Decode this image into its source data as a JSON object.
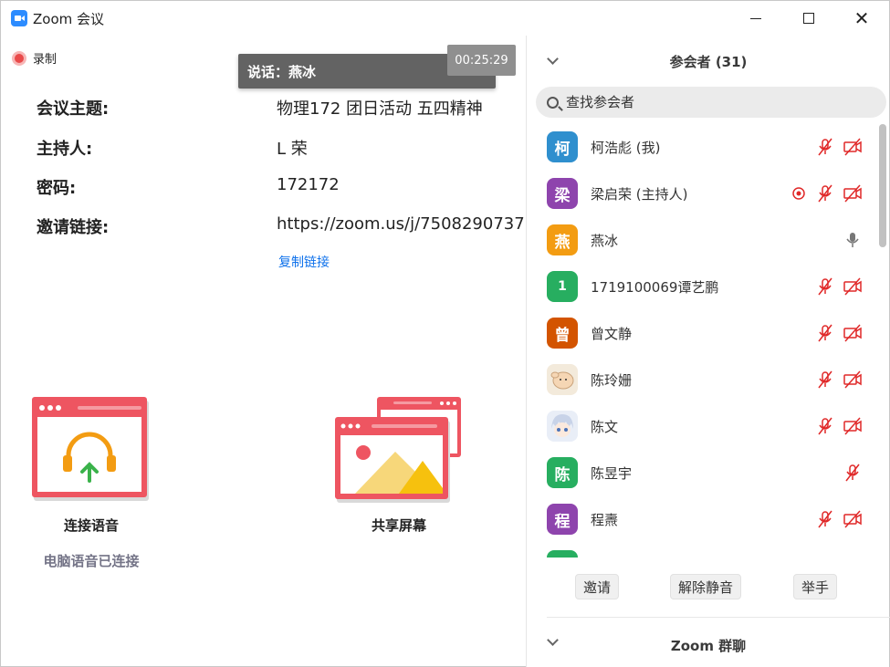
{
  "window": {
    "title": "Zoom 会议"
  },
  "recording": {
    "label": "录制"
  },
  "speaker_tip": "说话：燕冰",
  "timer": "00:25:29",
  "meeting_info": {
    "topic_key": "会议主题:",
    "topic_val": "物理172 团日活动 五四精神",
    "host_key": "主持人:",
    "host_val": "L 荣",
    "password_key": "密码:",
    "password_val": "172172",
    "link_key": "邀请链接:",
    "link_val": "https://zoom.us/j/7508290737",
    "copy_link": "复制链接"
  },
  "actions": {
    "audio_label": "连接语音",
    "audio_status": "电脑语音已连接",
    "share_label": "共享屏幕"
  },
  "participants_panel": {
    "title": "参会者 (31)",
    "search_placeholder": "查找参会者",
    "participants": [
      {
        "initial": "柯",
        "name": "柯浩彪 (我)",
        "avatar_color": "#2f8fce",
        "mic": "muted",
        "video": "off"
      },
      {
        "initial": "梁",
        "name": "梁启荣 (主持人)",
        "avatar_color": "#8e44ad",
        "recording": true,
        "mic": "muted",
        "video": "off"
      },
      {
        "initial": "燕",
        "name": "燕冰",
        "avatar_color": "#f39c12",
        "mic": "speaking"
      },
      {
        "initial": "1",
        "name": "1719100069谭艺鹏",
        "avatar_color": "#27ae60",
        "mic": "muted",
        "video": "off"
      },
      {
        "initial": "曾",
        "name": "曾文静",
        "avatar_color": "#d35400",
        "mic": "muted",
        "video": "off"
      },
      {
        "initial": "",
        "name": "陈玲姗",
        "avatar_image": "cartoon-hand",
        "mic": "muted",
        "video": "off"
      },
      {
        "initial": "",
        "name": "陈文",
        "avatar_image": "anime-character",
        "mic": "muted",
        "video": "off"
      },
      {
        "initial": "陈",
        "name": "陈昱宇",
        "avatar_color": "#27ae60",
        "mic": "muted"
      },
      {
        "initial": "程",
        "name": "程燾",
        "avatar_color": "#8e44ad",
        "mic": "muted",
        "video": "off"
      }
    ],
    "buttons": {
      "invite": "邀请",
      "unmute_all": "解除静音",
      "raise_hand": "举手"
    }
  },
  "chat_panel": {
    "title": "Zoom 群聊"
  },
  "colors": {
    "accent": "#0e71eb",
    "muted_red": "#e02828",
    "card_red": "#ee5561"
  }
}
